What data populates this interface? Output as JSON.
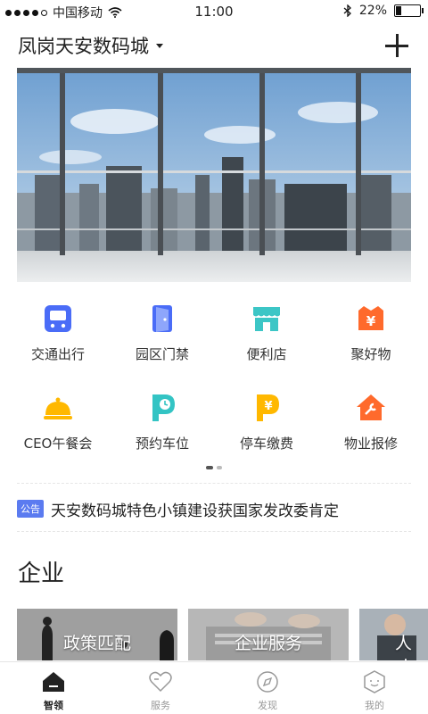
{
  "status_bar": {
    "carrier": "中国移动",
    "time": "11:00",
    "battery": "22%",
    "battery_level": 0.22
  },
  "header": {
    "location": "凤岗天安数码城"
  },
  "services": [
    {
      "label": "交通出行",
      "icon": "bus-icon",
      "color": "#4a6cf7"
    },
    {
      "label": "园区门禁",
      "icon": "door-icon",
      "color": "#4a6cf7"
    },
    {
      "label": "便利店",
      "icon": "store-icon",
      "color": "#3cc6c6"
    },
    {
      "label": "聚好物",
      "icon": "gift-box-icon",
      "color": "#ff6a2c"
    },
    {
      "label": "CEO午餐会",
      "icon": "dining-cloche-icon",
      "color": "#ffb800"
    },
    {
      "label": "预约车位",
      "icon": "parking-reserve-icon",
      "color": "#33c4c4"
    },
    {
      "label": "停车缴费",
      "icon": "parking-payment-icon",
      "color": "#ffb800"
    },
    {
      "label": "物业报修",
      "icon": "repair-house-icon",
      "color": "#ff6a2c"
    }
  ],
  "notice": {
    "tag": "公告",
    "text": "天安数码城特色小镇建设获国家发改委肯定"
  },
  "enterprise": {
    "title": "企业",
    "cards": [
      {
        "label": "政策匹配"
      },
      {
        "label": "企业服务"
      },
      {
        "label": "人才"
      }
    ]
  },
  "tabs": [
    {
      "label": "智领",
      "icon": "home-icon",
      "active": true
    },
    {
      "label": "服务",
      "icon": "heart-icon",
      "active": false
    },
    {
      "label": "发现",
      "icon": "compass-icon",
      "active": false
    },
    {
      "label": "我的",
      "icon": "profile-icon",
      "active": false
    }
  ]
}
